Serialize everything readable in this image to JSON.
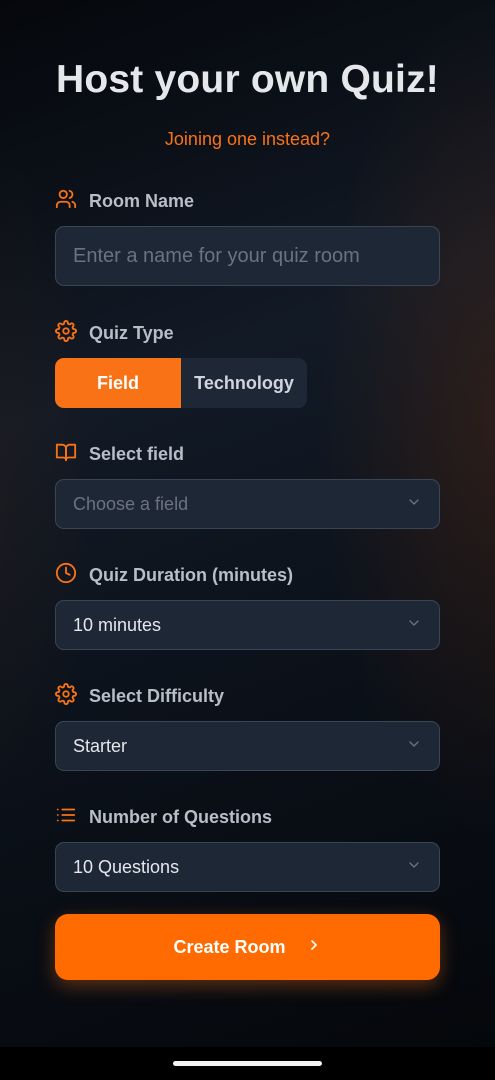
{
  "header": {
    "title": "Host your own Quiz!",
    "join_link": "Joining one instead?"
  },
  "room_name": {
    "label": "Room Name",
    "icon": "users-icon",
    "placeholder": "Enter a name for your quiz room",
    "value": ""
  },
  "quiz_type": {
    "label": "Quiz Type",
    "icon": "gear-icon",
    "options": [
      "Field",
      "Technology"
    ],
    "selected": "Field"
  },
  "select_field": {
    "label": "Select field",
    "icon": "book-open-icon",
    "placeholder": "Choose a field"
  },
  "quiz_duration": {
    "label": "Quiz Duration (minutes)",
    "icon": "clock-icon",
    "value": "10 minutes"
  },
  "difficulty": {
    "label": "Select Difficulty",
    "icon": "gear-icon",
    "value": "Starter"
  },
  "num_questions": {
    "label": "Number of Questions",
    "icon": "list-icon",
    "value": "10 Questions"
  },
  "create_button": {
    "label": "Create Room",
    "icon": "chevron-right-icon"
  },
  "colors": {
    "accent": "#f97316",
    "button": "#ff6b00",
    "field_bg": "#1e2735",
    "field_border": "#3a4554"
  }
}
